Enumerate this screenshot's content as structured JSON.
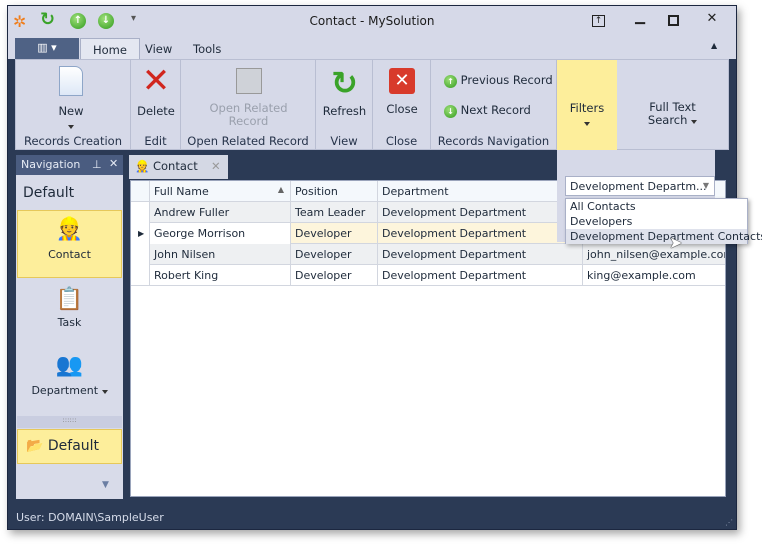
{
  "window": {
    "title": "Contact - MySolution"
  },
  "ribbon": {
    "tabs": [
      {
        "label": "Home",
        "active": true
      },
      {
        "label": "View"
      },
      {
        "label": "Tools"
      }
    ],
    "groups": {
      "records_creation": {
        "label": "Records Creation",
        "new": "New"
      },
      "edit": {
        "label": "Edit",
        "delete": "Delete"
      },
      "open_related": {
        "label": "Open Related Record",
        "button": "Open Related Record"
      },
      "view": {
        "label": "View",
        "refresh": "Refresh"
      },
      "close": {
        "label": "Close",
        "close": "Close"
      },
      "navigation": {
        "label": "Records Navigation",
        "previous": "Previous Record",
        "next": "Next Record"
      },
      "filters": {
        "label": "Filters"
      },
      "fts": {
        "label": "Full Text Search"
      }
    }
  },
  "navigation": {
    "title": "Navigation",
    "group": "Default",
    "items": [
      {
        "label": "Contact",
        "selected": true
      },
      {
        "label": "Task"
      },
      {
        "label": "Department"
      }
    ],
    "bottom_group": "Default"
  },
  "doc_tab": {
    "label": "Contact"
  },
  "grid": {
    "columns": [
      "Full Name",
      "Position",
      "Department"
    ],
    "rows": [
      {
        "name": "Andrew Fuller",
        "position": "Team Leader",
        "department": "Development Department",
        "email": ""
      },
      {
        "name": "George Morrison",
        "position": "Developer",
        "department": "Development Department",
        "email": "",
        "focused": true
      },
      {
        "name": "John Nilsen",
        "position": "Developer",
        "department": "Development Department",
        "email": "john_nilsen@example.com"
      },
      {
        "name": "Robert King",
        "position": "Developer",
        "department": "Development Department",
        "email": "king@example.com"
      }
    ]
  },
  "filters": {
    "selected": "Development Departm...",
    "options": [
      "All Contacts",
      "Developers",
      "Development Department Contacts"
    ],
    "hovered_index": 2
  },
  "status": {
    "user": "User: DOMAIN\\SampleUser"
  },
  "colors": {
    "frame": "#2b3a55",
    "ribbon": "#d6d9e8",
    "highlight": "#fdee9b",
    "focused_row": "#fdf5dc"
  }
}
